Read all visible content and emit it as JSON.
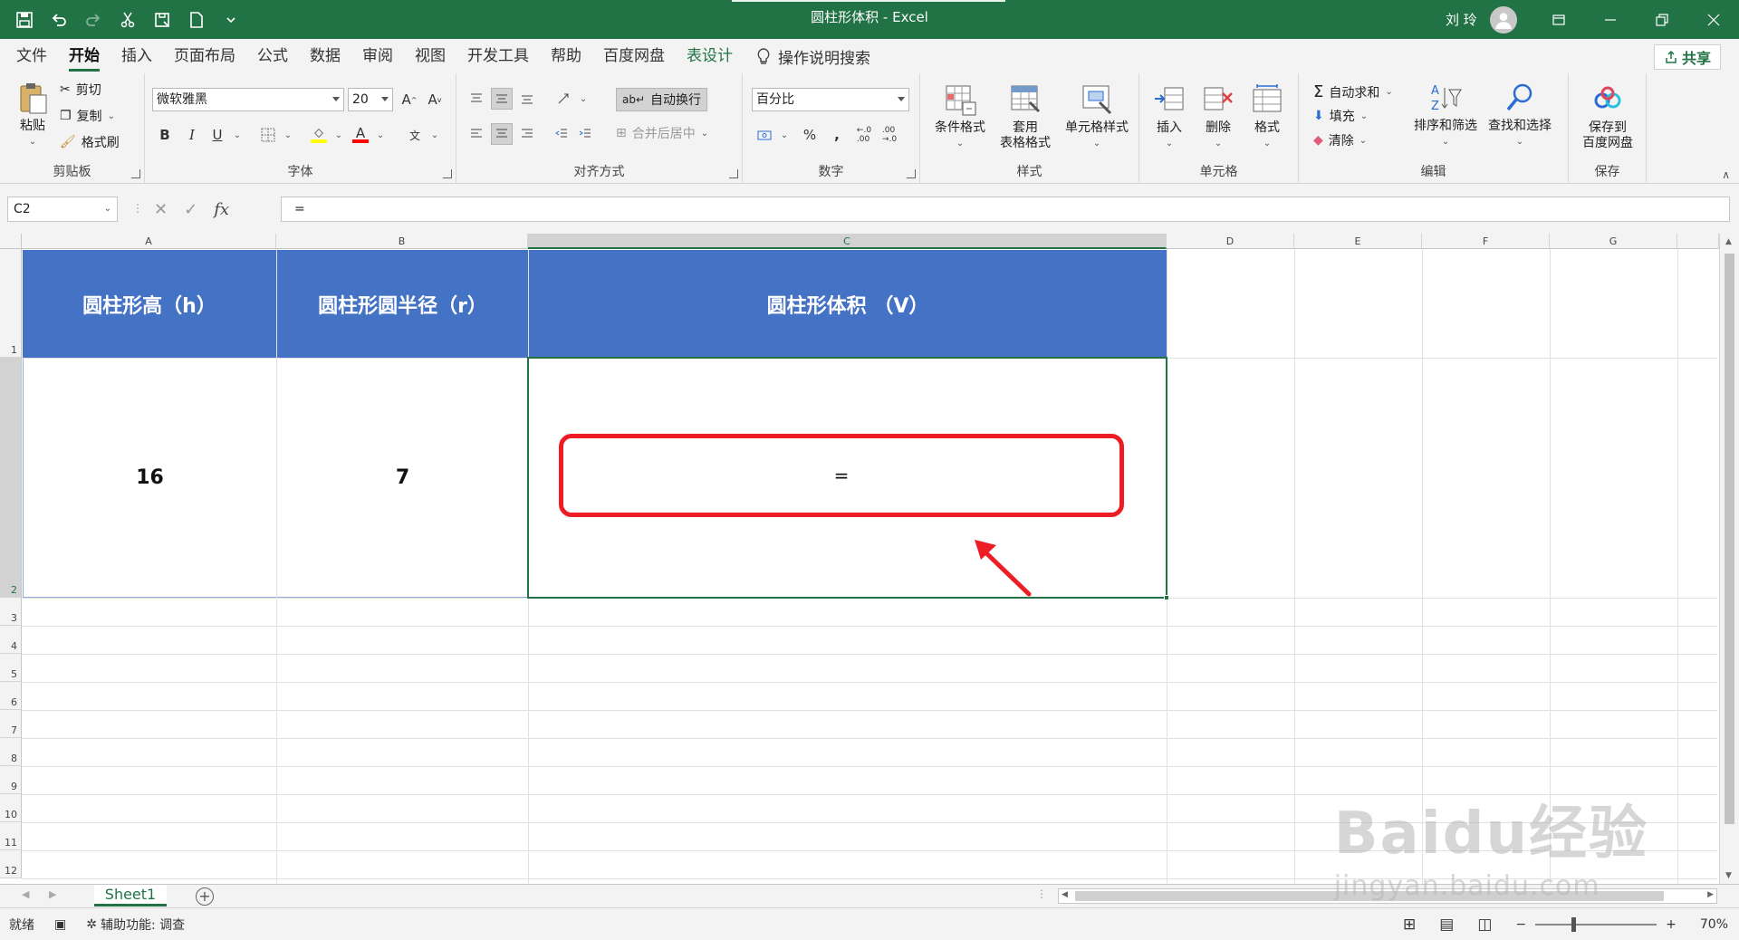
{
  "window": {
    "title": "圆柱形体积 - Excel",
    "user": "刘 玲"
  },
  "ribbon_tabs": [
    "文件",
    "开始",
    "插入",
    "页面布局",
    "公式",
    "数据",
    "审阅",
    "视图",
    "开发工具",
    "帮助",
    "百度网盘",
    "表设计"
  ],
  "tell_me": "操作说明搜索",
  "share": "共享",
  "clipboard": {
    "label": "剪贴板",
    "paste": "粘贴",
    "cut": "剪切",
    "copy": "复制",
    "format_painter": "格式刷"
  },
  "font": {
    "label": "字体",
    "name": "微软雅黑",
    "size": "20"
  },
  "alignment": {
    "label": "对齐方式",
    "wrap_text": "自动换行",
    "merge_center": "合并后居中"
  },
  "number": {
    "label": "数字",
    "format": "百分比"
  },
  "styles": {
    "label": "样式",
    "conditional": "条件格式",
    "table_style_1": "套用",
    "table_style_2": "表格格式",
    "cell_style": "单元格样式"
  },
  "cells": {
    "label": "单元格",
    "insert": "插入",
    "delete": "删除",
    "format": "格式"
  },
  "editing": {
    "label": "编辑",
    "autosum": "自动求和",
    "fill": "填充",
    "clear": "清除",
    "sort_filter": "排序和筛选",
    "find_select": "查找和选择"
  },
  "save_group": {
    "label": "保存",
    "save_line1": "保存到",
    "save_line2": "百度网盘"
  },
  "formula_bar": {
    "name_box": "C2",
    "formula": "="
  },
  "columns": [
    "A",
    "B",
    "C",
    "D",
    "E",
    "F",
    "G"
  ],
  "rows": [
    "1",
    "2",
    "3",
    "4",
    "5",
    "6",
    "7",
    "8",
    "9",
    "10",
    "11",
    "12"
  ],
  "sheet": {
    "header": [
      "圆柱形高（h）",
      "圆柱形圆半径（r）",
      "圆柱形体积 （V）"
    ],
    "row2": [
      "16",
      "7",
      "="
    ]
  },
  "sheet_tabs": [
    "Sheet1"
  ],
  "status": {
    "ready": "就绪",
    "accessibility": "辅助功能: 调查",
    "zoom": "70%"
  },
  "watermark": {
    "line1": "Baidu经验",
    "line2": "jingyan.baidu.com"
  },
  "colors": {
    "excel_green": "#217346",
    "header_fill": "#4472c4",
    "callout_red": "#ee1c25"
  }
}
